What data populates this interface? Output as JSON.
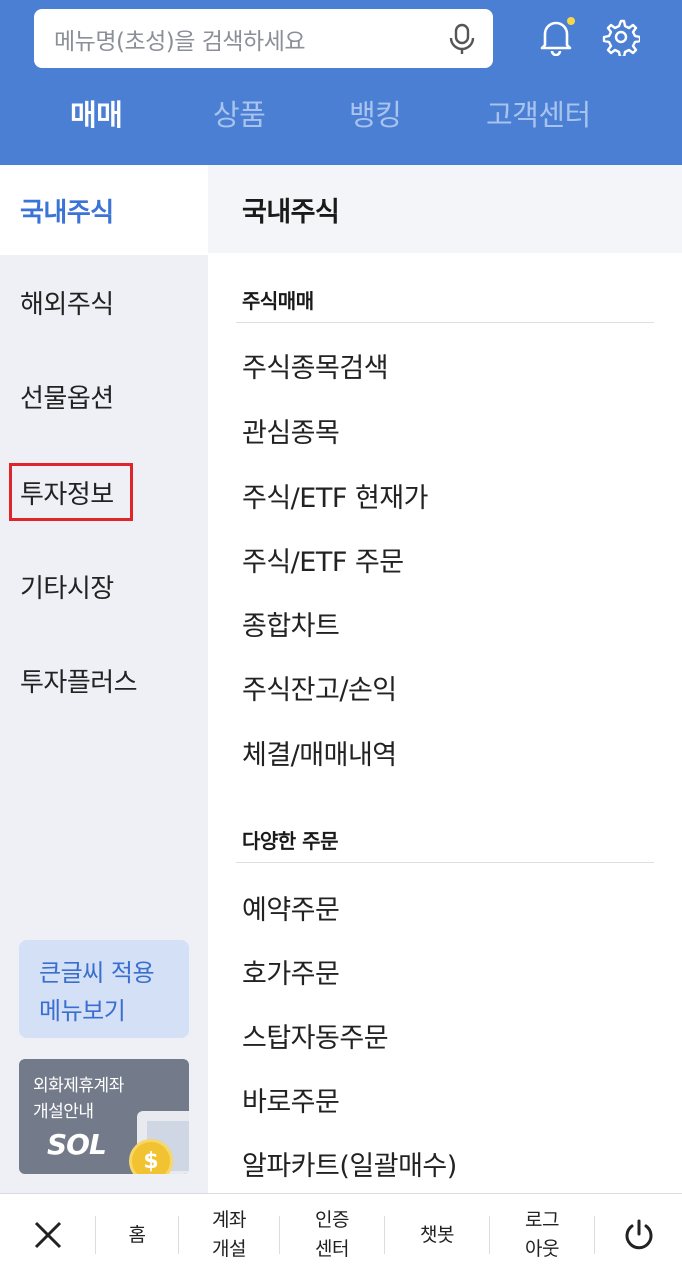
{
  "search": {
    "placeholder": "메뉴명(초성)을 검색하세요"
  },
  "main_tabs": [
    {
      "label": "매매",
      "active": true
    },
    {
      "label": "상품",
      "active": false
    },
    {
      "label": "뱅킹",
      "active": false
    },
    {
      "label": "고객센터",
      "active": false
    }
  ],
  "categories": [
    {
      "label": "국내주식",
      "active": true
    },
    {
      "label": "해외주식",
      "active": false
    },
    {
      "label": "선물옵션",
      "active": false
    },
    {
      "label": "투자정보",
      "active": false,
      "highlighted": true
    },
    {
      "label": "기타시장",
      "active": false
    },
    {
      "label": "투자플러스",
      "active": false
    }
  ],
  "bigfont_card": {
    "line1": "큰글씨 적용",
    "line2": "메뉴보기"
  },
  "fx_card": {
    "line1": "외화제휴계좌",
    "line2": "개설안내",
    "logo": "SOL",
    "coin_symbol": "$"
  },
  "panel": {
    "title": "국내주식",
    "sections": [
      {
        "title": "주식매매",
        "items": [
          "주식종목검색",
          "관심종목",
          "주식/ETF 현재가",
          "주식/ETF 주문",
          "종합차트",
          "주식잔고/손익",
          "체결/매매내역"
        ]
      },
      {
        "title": "다양한 주문",
        "items": [
          "예약주문",
          "호가주문",
          "스탑자동주문",
          "바로주문",
          "알파카트(일괄매수)"
        ]
      }
    ]
  },
  "bottom_bar": {
    "close_icon": "close-icon",
    "items": [
      {
        "line1": "홈",
        "line2": ""
      },
      {
        "line1": "계좌",
        "line2": "개설"
      },
      {
        "line1": "인증",
        "line2": "센터"
      },
      {
        "line1": "챗봇",
        "line2": ""
      },
      {
        "line1": "로그",
        "line2": "아웃"
      }
    ],
    "power_icon": "power-icon"
  },
  "colors": {
    "header_bg": "#4a7fd4",
    "accent": "#3b73d6",
    "highlight_border": "#e0242b",
    "left_bg": "#eef0f6"
  }
}
